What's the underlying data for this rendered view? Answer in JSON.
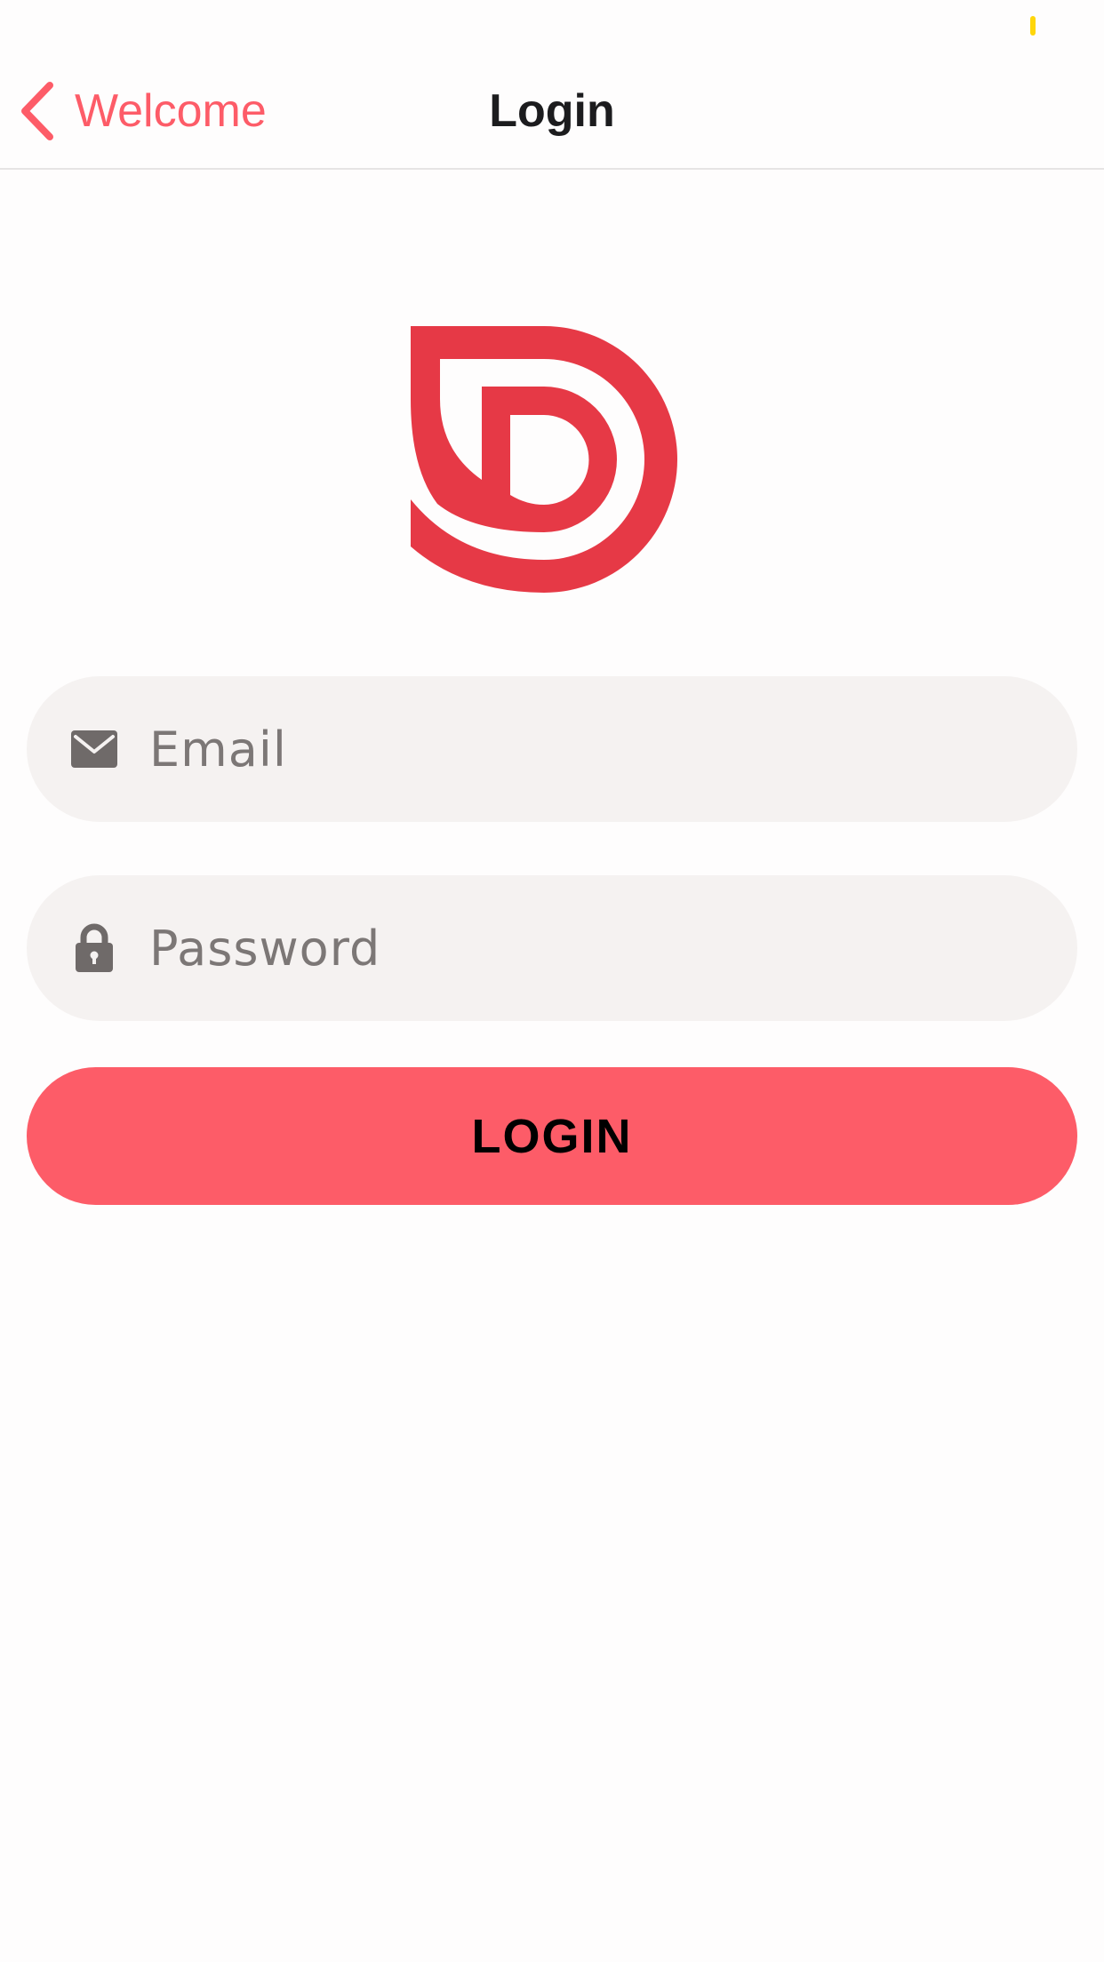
{
  "status_bar": {
    "battery_color": "#ffd60a"
  },
  "nav": {
    "back_label": "Welcome",
    "back_icon": "chevron-left-icon",
    "title": "Login"
  },
  "logo": {
    "icon": "brand-d-logo",
    "color": "#e63946"
  },
  "form": {
    "email": {
      "icon": "envelope-icon",
      "placeholder": "Email",
      "value": ""
    },
    "password": {
      "icon": "lock-icon",
      "placeholder": "Password",
      "value": ""
    },
    "submit_label": "LOGIN"
  },
  "colors": {
    "accent": "#fd5c68",
    "field_background": "#f5f2f1",
    "icon_gray": "#6f6a69",
    "page_background": "#fefdfd"
  }
}
